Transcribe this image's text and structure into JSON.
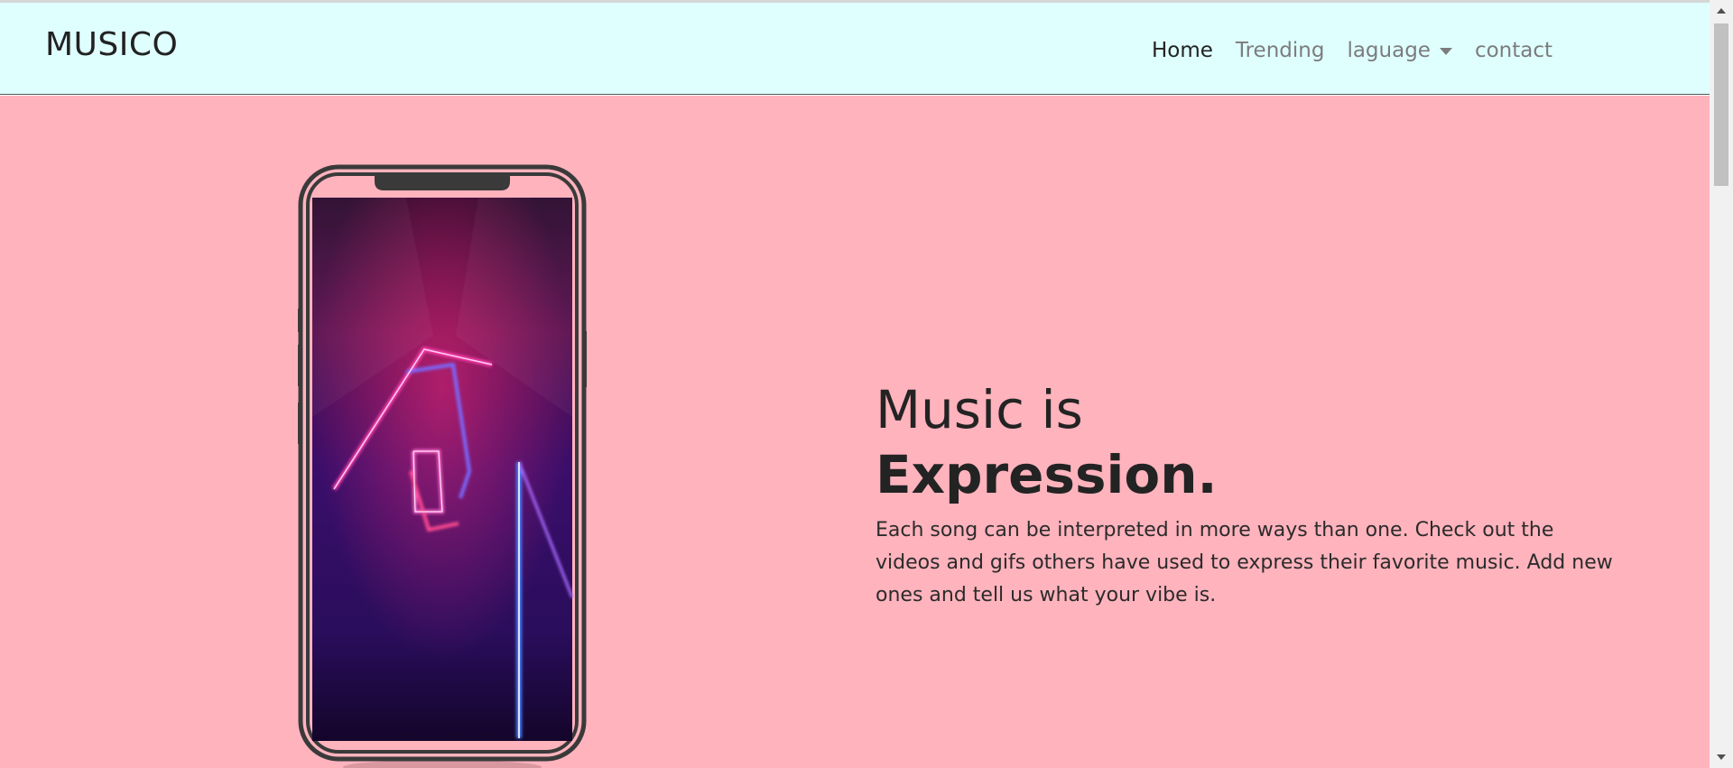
{
  "navbar": {
    "brand": "MUSICO",
    "links": [
      {
        "label": "Home",
        "active": true
      },
      {
        "label": "Trending",
        "active": false
      },
      {
        "label": "laguage",
        "active": false,
        "dropdown": true
      },
      {
        "label": "contact",
        "active": false
      }
    ]
  },
  "hero": {
    "title_line1": "Music is",
    "title_line2": "Expression.",
    "description": "Each song can be interpreted in more ways than one. Check out the videos and gifs others have used to express their favorite music. Add new ones and tell us what your vibe is."
  },
  "colors": {
    "navbar_bg": "#dfffff",
    "hero_bg": "#ffb3bd",
    "text": "#232323",
    "nav_inactive": "#7c7c7c"
  },
  "icons": [
    "phone-mockup-image",
    "dropdown-caret-icon",
    "scroll-up-arrow",
    "scroll-down-arrow"
  ]
}
